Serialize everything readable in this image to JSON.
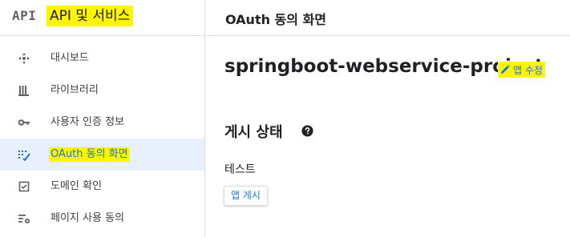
{
  "sidebar": {
    "logo_text": "API",
    "title": "API 및 서비스",
    "items": [
      {
        "label": "대시보드",
        "icon": "dashboard-icon"
      },
      {
        "label": "라이브러리",
        "icon": "library-icon"
      },
      {
        "label": "사용자 인증 정보",
        "icon": "key-icon"
      },
      {
        "label": "OAuth 동의 화면",
        "icon": "consent-icon",
        "active": true
      },
      {
        "label": "도메인 확인",
        "icon": "domain-check-icon"
      },
      {
        "label": "페이지 사용 동의",
        "icon": "settings-list-icon"
      }
    ]
  },
  "header": {
    "title": "OAuth 동의 화면"
  },
  "main": {
    "project_name": "springboot-webservice-project",
    "edit_label": "앱 수정",
    "section_title": "게시 상태",
    "status": "테스트",
    "publish_label": "앱 게시"
  },
  "colors": {
    "accent": "#1a73e8",
    "highlight": "#fcf400",
    "active_bg": "#e8f0fe",
    "border": "#dadce0"
  }
}
